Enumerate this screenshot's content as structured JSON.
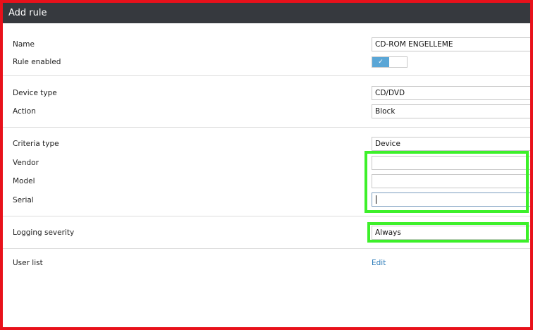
{
  "window": {
    "title": "Add rule"
  },
  "form": {
    "name": {
      "label": "Name",
      "value": "CD-ROM ENGELLEME"
    },
    "rule_enabled": {
      "label": "Rule enabled",
      "checked": true,
      "check_glyph": "✓"
    },
    "device_type": {
      "label": "Device type",
      "value": "CD/DVD"
    },
    "action": {
      "label": "Action",
      "value": "Block"
    },
    "criteria_type": {
      "label": "Criteria type",
      "value": "Device"
    },
    "vendor": {
      "label": "Vendor",
      "value": ""
    },
    "model": {
      "label": "Model",
      "value": ""
    },
    "serial": {
      "label": "Serial",
      "value": ""
    },
    "logging_severity": {
      "label": "Logging severity",
      "value": "Always"
    },
    "user_list": {
      "label": "User list",
      "link": "Edit"
    }
  },
  "colors": {
    "frame_border": "#e8111b",
    "highlight": "#3df02a",
    "title_bar": "#36393e",
    "toggle_on": "#5aa6d6",
    "link": "#2a7ab8"
  }
}
